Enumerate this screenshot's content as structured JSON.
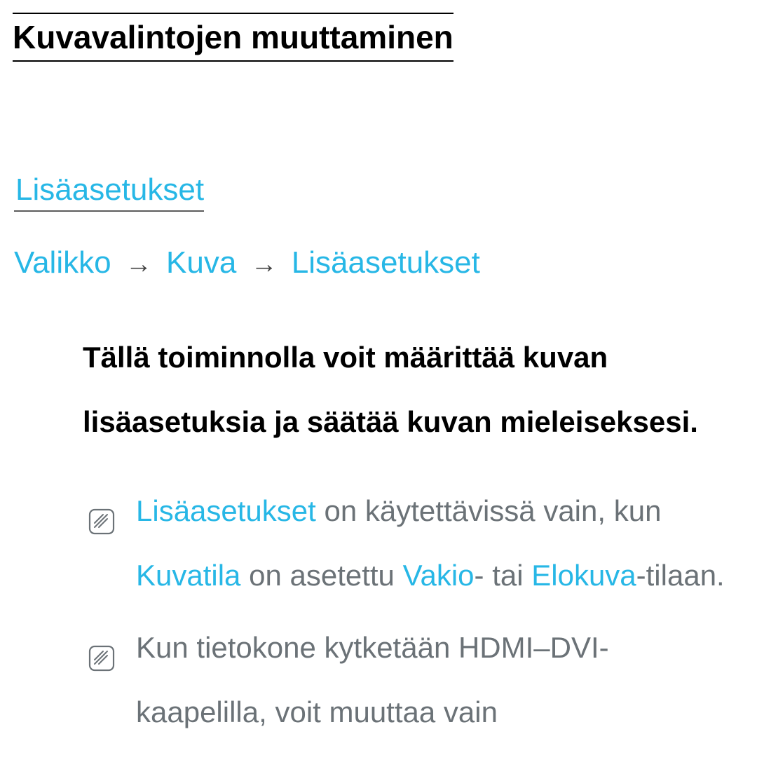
{
  "page_title": "Kuvavalintojen muuttaminen",
  "section_heading": "Lisäasetukset",
  "breadcrumb": {
    "item1": "Valikko",
    "item2": "Kuva",
    "item3": "Lisäasetukset",
    "arrow": "→"
  },
  "body": "Tällä toiminnolla voit määrittää kuvan lisäasetuksia ja säätää kuvan mieleiseksesi.",
  "notes": [
    {
      "hl1": "Lisäasetukset",
      "t1": " on käytettävissä vain, kun ",
      "hl2": "Kuvatila",
      "t2": " on asetettu ",
      "hl3": "Vakio",
      "t3": "- tai ",
      "hl4": "Elokuva",
      "t4": "-tilaan."
    },
    {
      "t1": "Kun tietokone kytketään HDMI–DVI-kaapelilla, voit muuttaa vain"
    }
  ]
}
